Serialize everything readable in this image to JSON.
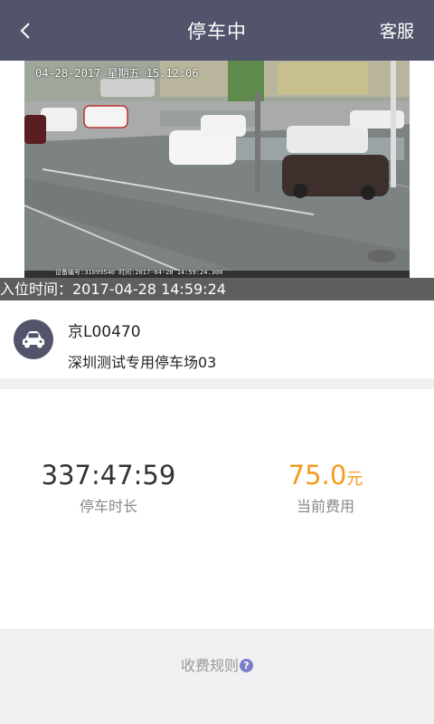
{
  "header": {
    "title": "停车中",
    "service_label": "客服",
    "back_icon": "chevron-left-icon"
  },
  "camera": {
    "overlay_timestamp": "04-28-2017  星期五  15:12:06",
    "overlay_device": "设备编号:31099540 时间:2017-04-28 14:59:24.300",
    "entry_time_label": "入位时间：2017-04-28 14:59:24"
  },
  "vehicle": {
    "icon": "car-icon",
    "plate": "京L00470",
    "lot": "深圳测试专用停车场03"
  },
  "stats": {
    "duration_value": "337:47:59",
    "duration_label": "停车时长",
    "fee_value": "75.0",
    "fee_unit": "元",
    "fee_label": "当前费用"
  },
  "footer": {
    "rules_label": "收费规则",
    "help_icon": "question-icon",
    "help_glyph": "?"
  },
  "colors": {
    "header_bg": "#52546b",
    "fee_accent": "#f39c1f",
    "help_icon": "#7a7ec8"
  }
}
